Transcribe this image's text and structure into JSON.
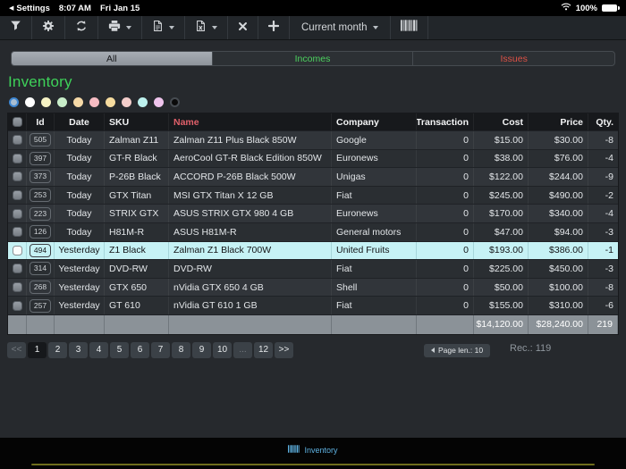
{
  "colors": {
    "accent_green": "#3ed159",
    "accent_red": "#dd5146",
    "name_header_red": "#e0606a",
    "selected_row_bg": "#c6f2f5",
    "tab_accent": "#5fb3e3",
    "home_indicator": "#6f6e1d"
  },
  "status_bar": {
    "back_label": "Settings",
    "time": "8:07 AM",
    "date": "Fri Jan 15",
    "battery_pct": "100%"
  },
  "toolbar": {
    "period_label": "Current month"
  },
  "segments": [
    {
      "label": "All",
      "selected": true
    },
    {
      "label": "Incomes",
      "color": "#4cd25f"
    },
    {
      "label": "Issues",
      "color": "#dd5146"
    }
  ],
  "page_title": "Inventory",
  "color_dots": [
    {
      "fill": "#a9bed2",
      "ring": "#3f87d2",
      "selected": true
    },
    {
      "fill": "#ffffff"
    },
    {
      "fill": "#f6f3c5"
    },
    {
      "fill": "#c8edc9"
    },
    {
      "fill": "#f6d9a7"
    },
    {
      "fill": "#f6bcc3"
    },
    {
      "fill": "#f6dc9f"
    },
    {
      "fill": "#f3cdca"
    },
    {
      "fill": "#bdf1ee"
    },
    {
      "fill": "#efc4ec"
    },
    {
      "fill": "#0a0a0a",
      "ring": "#464b51"
    }
  ],
  "table": {
    "columns": [
      {
        "key": "check",
        "label": "",
        "align": "center"
      },
      {
        "key": "id",
        "label": "Id",
        "align": "center"
      },
      {
        "key": "date",
        "label": "Date",
        "align": "center"
      },
      {
        "key": "sku",
        "label": "SKU",
        "align": "left"
      },
      {
        "key": "name",
        "label": "Name",
        "align": "left",
        "color": "#e0606a"
      },
      {
        "key": "company",
        "label": "Company",
        "align": "left"
      },
      {
        "key": "transaction",
        "label": "Transaction",
        "align": "right"
      },
      {
        "key": "cost",
        "label": "Cost",
        "align": "right"
      },
      {
        "key": "price",
        "label": "Price",
        "align": "right"
      },
      {
        "key": "qty",
        "label": "Qty.",
        "align": "right"
      }
    ],
    "rows": [
      {
        "id": "505",
        "date": "Today",
        "sku": "Zalman Z11",
        "name": "Zalman Z11 Plus Black 850W",
        "company": "Google",
        "transaction": "0",
        "cost": "$15.00",
        "price": "$30.00",
        "qty": "-8"
      },
      {
        "id": "397",
        "date": "Today",
        "sku": "GT-R Black",
        "name": "AeroCool GT-R Black Edition 850W",
        "company": "Euronews",
        "transaction": "0",
        "cost": "$38.00",
        "price": "$76.00",
        "qty": "-4"
      },
      {
        "id": "373",
        "date": "Today",
        "sku": "P-26B Black",
        "name": "ACCORD P-26B Black 500W",
        "company": "Unigas",
        "transaction": "0",
        "cost": "$122.00",
        "price": "$244.00",
        "qty": "-9"
      },
      {
        "id": "253",
        "date": "Today",
        "sku": "GTX Titan",
        "name": "MSI GTX Titan X 12 GB",
        "company": "Fiat",
        "transaction": "0",
        "cost": "$245.00",
        "price": "$490.00",
        "qty": "-2"
      },
      {
        "id": "223",
        "date": "Today",
        "sku": "STRIX GTX",
        "name": "ASUS STRIX GTX 980 4 GB",
        "company": "Euronews",
        "transaction": "0",
        "cost": "$170.00",
        "price": "$340.00",
        "qty": "-4"
      },
      {
        "id": "126",
        "date": "Today",
        "sku": "H81M-R",
        "name": "ASUS H81M-R",
        "company": "General motors",
        "transaction": "0",
        "cost": "$47.00",
        "price": "$94.00",
        "qty": "-3"
      },
      {
        "id": "494",
        "date": "Yesterday",
        "sku": "Z1 Black",
        "name": "Zalman Z1 Black 700W",
        "company": "United Fruits",
        "transaction": "0",
        "cost": "$193.00",
        "price": "$386.00",
        "qty": "-1",
        "selected": true
      },
      {
        "id": "314",
        "date": "Yesterday",
        "sku": "DVD-RW",
        "name": "DVD-RW",
        "company": "Fiat",
        "transaction": "0",
        "cost": "$225.00",
        "price": "$450.00",
        "qty": "-3"
      },
      {
        "id": "268",
        "date": "Yesterday",
        "sku": "GTX 650",
        "name": "nVidia GTX 650 4 GB",
        "company": "Shell",
        "transaction": "0",
        "cost": "$50.00",
        "price": "$100.00",
        "qty": "-8"
      },
      {
        "id": "257",
        "date": "Yesterday",
        "sku": "GT 610",
        "name": "nVidia GT 610 1 GB",
        "company": "Fiat",
        "transaction": "0",
        "cost": "$155.00",
        "price": "$310.00",
        "qty": "-6"
      }
    ],
    "totals": {
      "cost": "$14,120.00",
      "price": "$28,240.00",
      "qty": "219"
    }
  },
  "pagination": {
    "buttons": [
      {
        "label": "<<",
        "state": "disabled"
      },
      {
        "label": "1",
        "state": "active"
      },
      {
        "label": "2"
      },
      {
        "label": "3"
      },
      {
        "label": "4"
      },
      {
        "label": "5"
      },
      {
        "label": "6"
      },
      {
        "label": "7"
      },
      {
        "label": "8"
      },
      {
        "label": "9"
      },
      {
        "label": "10"
      },
      {
        "label": "...",
        "state": "disabled"
      },
      {
        "label": "12"
      },
      {
        "label": ">>"
      }
    ],
    "page_len_label": "Page len.: 10",
    "records_label": "Rec.: 119"
  },
  "tab_bar": {
    "items": [
      {
        "label": "Inventory",
        "active": true
      }
    ]
  }
}
